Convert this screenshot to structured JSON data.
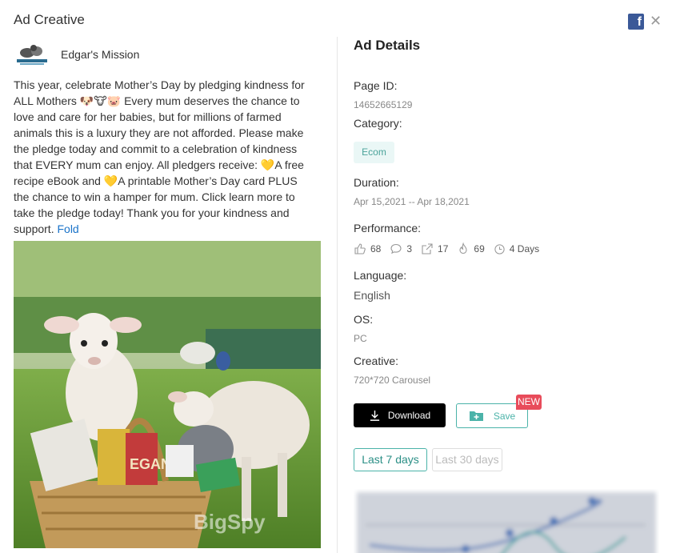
{
  "header": {
    "title": "Ad Creative"
  },
  "advertiser": {
    "name": "Edgar's Mission"
  },
  "ad": {
    "text": "This year, celebrate Mother’s Day by pledging kindness for ALL Mothers 🐶🐮🐷 Every mum deserves the chance to love and care for her babies, but for millions of farmed animals this is a luxury they are not afforded. Please make the pledge today and commit to a celebration of kindness that EVERY mum can enjoy. All pledgers receive:  💛A free recipe eBook and  💛A printable Mother’s Day card  PLUS the chance to win a hamper for mum. Click learn more to take the pledge today!  Thank you for your kindness and support.",
    "fold_label": "Fold",
    "image_watermark": "BigSpy"
  },
  "details": {
    "title": "Ad Details",
    "page_id_label": "Page ID:",
    "page_id": "14652665129",
    "category_label": "Category:",
    "category": "Ecom",
    "duration_label": "Duration:",
    "duration": "Apr 15,2021 -- Apr 18,2021",
    "performance_label": "Performance:",
    "performance": {
      "likes": "68",
      "comments": "3",
      "shares": "17",
      "hot": "69",
      "days": "4 Days"
    },
    "language_label": "Language:",
    "language": "English",
    "os_label": "OS:",
    "os": "PC",
    "creative_label": "Creative:",
    "creative": "720*720 Carousel"
  },
  "actions": {
    "download_label": "Download",
    "save_label": "Save",
    "new_badge": "NEW"
  },
  "tabs": [
    {
      "label": "Last 7 days",
      "active": true
    },
    {
      "label": "Last 30 days",
      "active": false
    }
  ],
  "colors": {
    "accent": "#4bb3a9",
    "facebook": "#3b5998",
    "badge": "#e84c5b",
    "link": "#1a73c9"
  }
}
